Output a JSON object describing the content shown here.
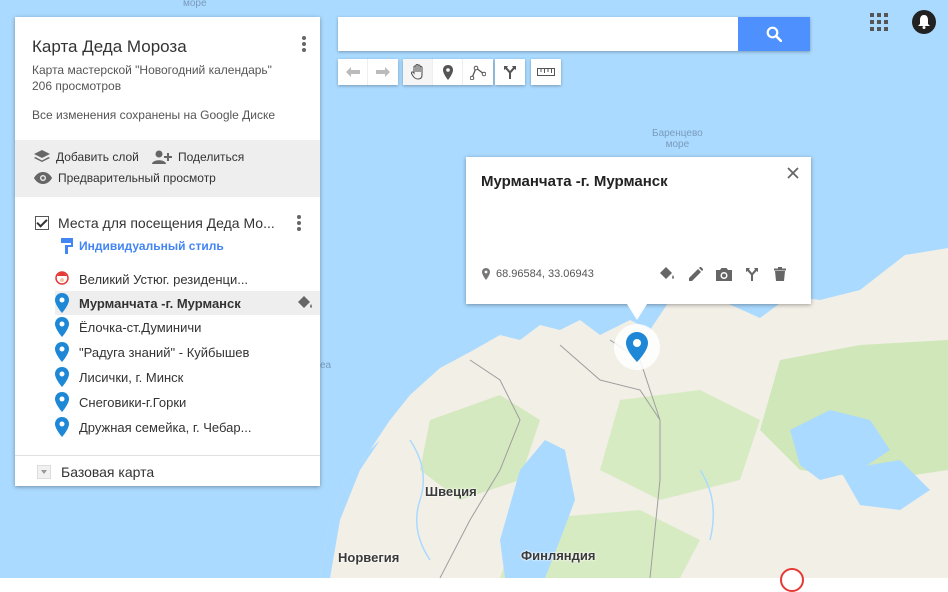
{
  "panel": {
    "title": "Карта Деда Мороза",
    "description": "Карта мастерской \"Новогодний календарь\"",
    "views": "206 просмотров",
    "saved": "Все изменения сохранены на Google Диске",
    "actions": {
      "add_layer": "Добавить слой",
      "share": "Поделиться",
      "preview": "Предварительный просмотр"
    },
    "layer": {
      "name": "Места для посещения Деда Мо...",
      "style_link": "Индивидуальный стиль",
      "places": [
        {
          "label": "Великий Устюг. резиденци...",
          "icon": "santa-icon"
        },
        {
          "label": "Мурманчата -г. Мурманск",
          "icon": "blue-pin-icon",
          "selected": true
        },
        {
          "label": "Ёлочка-ст.Думиничи",
          "icon": "blue-pin-icon"
        },
        {
          "label": "\"Радуга знаний\" - Куйбышев",
          "icon": "blue-pin-icon"
        },
        {
          "label": "Лисички, г. Минск",
          "icon": "blue-pin-icon"
        },
        {
          "label": "Снеговики-г.Горки",
          "icon": "blue-pin-icon"
        },
        {
          "label": "Дружная семейка,  г. Чебар...",
          "icon": "blue-pin-icon"
        }
      ]
    },
    "basemap": "Базовая карта"
  },
  "search": {
    "placeholder": "",
    "value": ""
  },
  "info_window": {
    "title": "Мурманчата -г. Мурманск",
    "coords": "68.96584, 33.06943"
  },
  "map_labels": {
    "sea_top": "море",
    "barents": "Баренцево\nморе",
    "sea_left": "еа",
    "sweden": "Швеция",
    "norway": "Норвегия",
    "finland": "Финляндия"
  },
  "colors": {
    "accent": "#4285f4",
    "pin": "#1e88d6",
    "water": "#aadaff",
    "land": "#f3f0e4",
    "forest": "#c8e6b4"
  }
}
